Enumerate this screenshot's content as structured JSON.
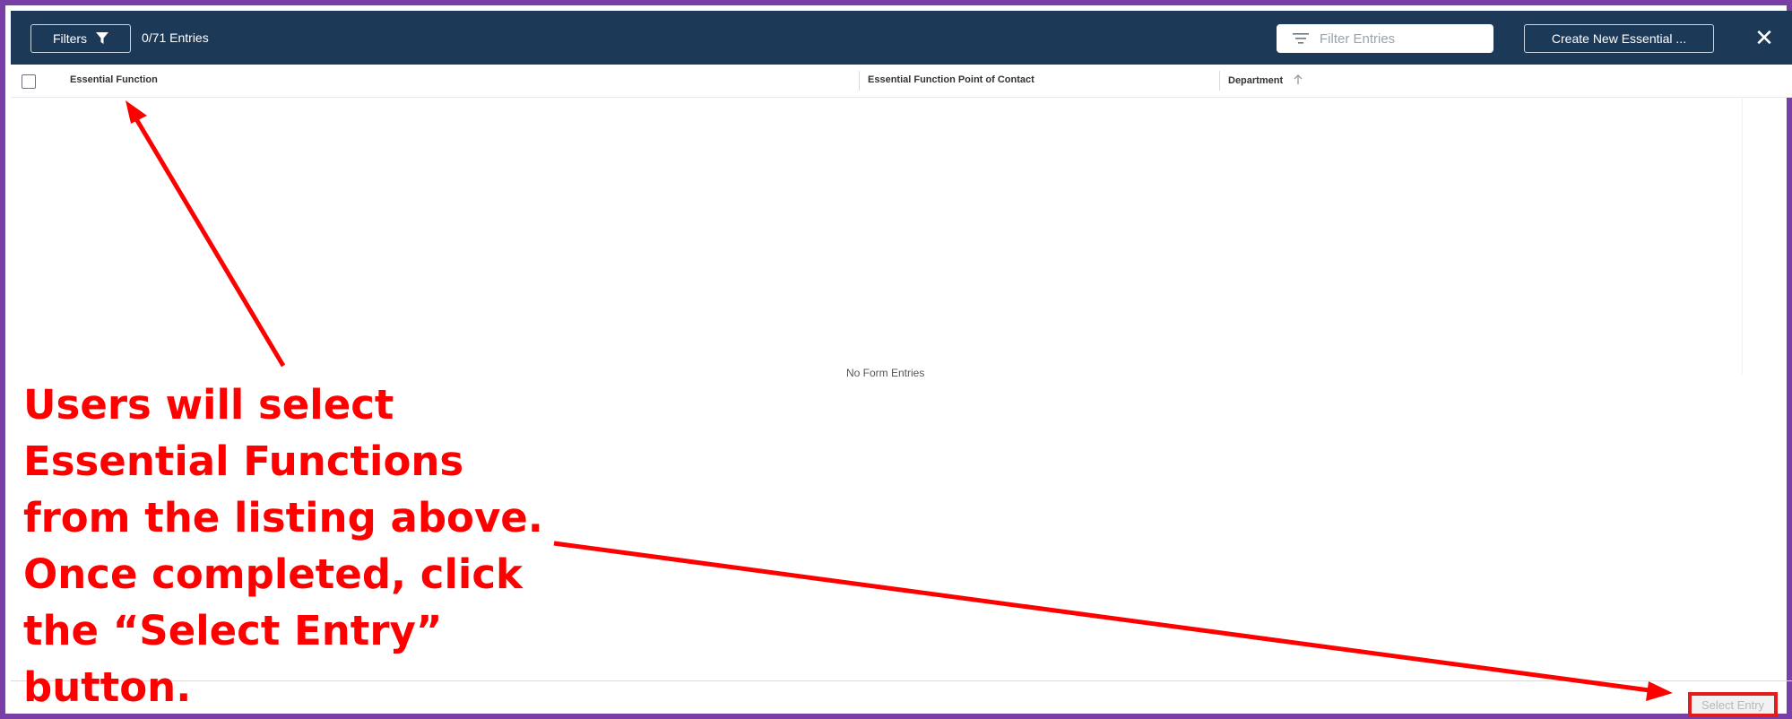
{
  "header": {
    "filters_label": "Filters",
    "entries_count": "0/71 Entries",
    "filter_placeholder": "Filter Entries",
    "create_label": "Create New Essential ...",
    "close_symbol": "✕"
  },
  "table": {
    "columns": [
      "Essential Function",
      "Essential Function Point of Contact",
      "Department"
    ],
    "sort_icon": "arrow-up-icon",
    "empty_message": "No Form Entries"
  },
  "footer": {
    "select_entry_label": "Select Entry"
  },
  "annotation": {
    "lines": [
      "Users will select",
      "Essential Functions",
      "from the listing above.",
      "Once completed, click",
      "the “Select Entry”",
      "button."
    ],
    "color": "#ff0000"
  },
  "colors": {
    "header_bg": "#1c3a57",
    "frame_border": "#7a3fa6",
    "highlight_red": "#e31b1b"
  }
}
